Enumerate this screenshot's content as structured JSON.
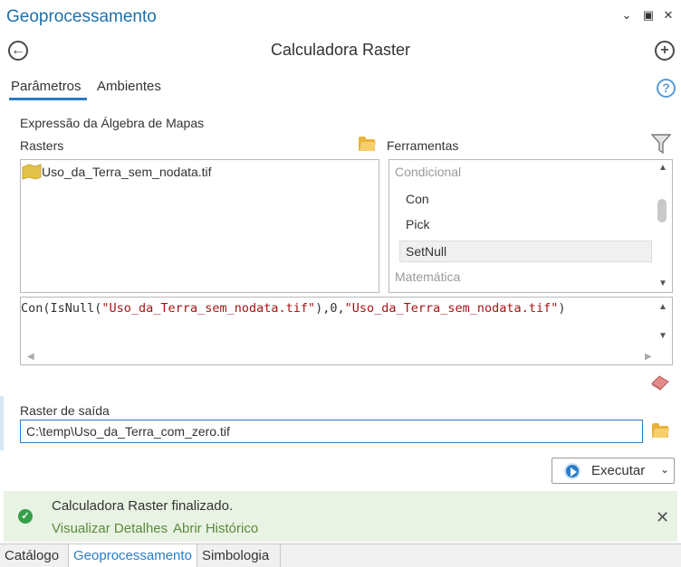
{
  "window": {
    "title": "Geoprocessamento",
    "chevron_glyph": "⌄",
    "maximize_glyph": "▣",
    "close_glyph": "✕"
  },
  "header": {
    "tool_title": "Calculadora Raster",
    "back_glyph": "←",
    "add_glyph": "+"
  },
  "tabs": {
    "params": "Parâmetros",
    "env": "Ambientes",
    "help_glyph": "?"
  },
  "expression": {
    "section_label": "Expressão da Álgebra de Mapas",
    "rasters_label": "Rasters",
    "tools_label": "Ferramentas",
    "rasters": [
      "Uso_da_Terra_sem_nodata.tif"
    ],
    "tools": {
      "category1": "Condicional",
      "items": [
        "Con",
        "Pick",
        "SetNull"
      ],
      "category2": "Matemática"
    },
    "text_parts": {
      "p1": "Con(IsNull(",
      "s1": "\"Uso_da_Terra_sem_nodata.tif\"",
      "p2": "),0,",
      "s2": "\"Uso_da_Terra_sem_nodata.tif\"",
      "p3": ")"
    }
  },
  "output": {
    "label": "Raster de saída",
    "value": "C:\\temp\\Uso_da_Terra_com_zero.tif"
  },
  "run": {
    "label": "Executar",
    "caret": "⌄"
  },
  "status": {
    "message": "Calculadora Raster finalizado.",
    "link_details": "Visualizar Detalhes",
    "link_history": "Abrir Histórico",
    "check_glyph": "✓",
    "close_glyph": "✕",
    "color": "#35a04a"
  },
  "bottom_tabs": [
    "Catálogo",
    "Geoprocessamento",
    "Simbologia"
  ],
  "colors": {
    "accent": "#2a7cc7",
    "title": "#1f6fa8",
    "string": "#a31515",
    "folder": "#e8b33a"
  }
}
